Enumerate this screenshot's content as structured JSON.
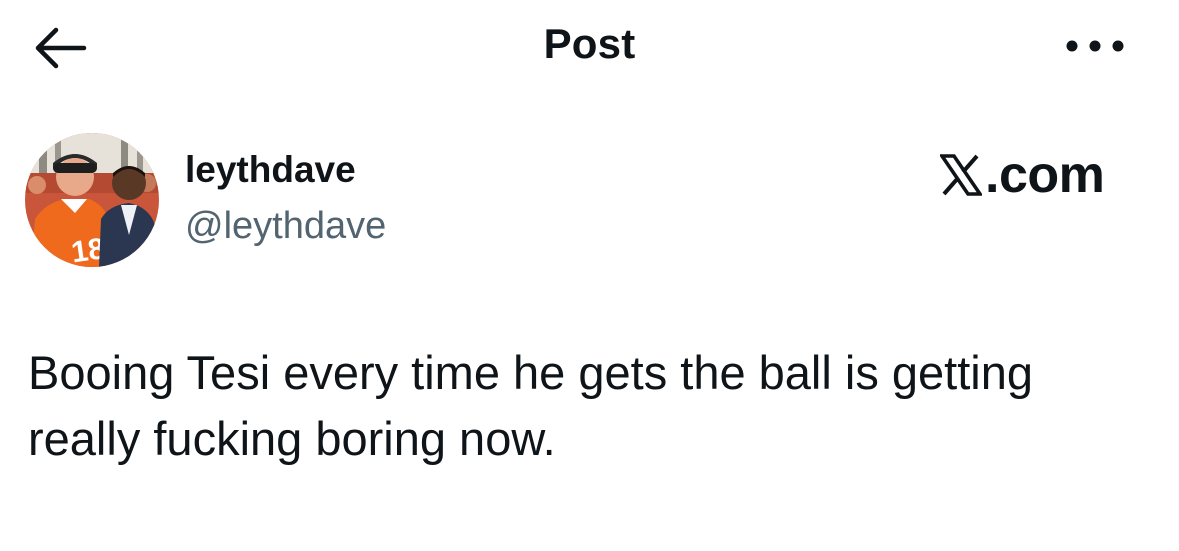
{
  "header": {
    "title": "Post",
    "back_icon": "arrow-left-icon",
    "more_icon": "more-horizontal-icon"
  },
  "author": {
    "display_name": "leythdave",
    "handle": "@leythdave",
    "avatar": "profile-photo"
  },
  "brand": {
    "icon": "x-logo-icon",
    "domain": ".com"
  },
  "post": {
    "text": "Booing Tesi every time he gets the ball is getting really fucking boring now."
  },
  "colors": {
    "text_primary": "#0f1419",
    "text_secondary": "#536471",
    "background": "#ffffff"
  }
}
